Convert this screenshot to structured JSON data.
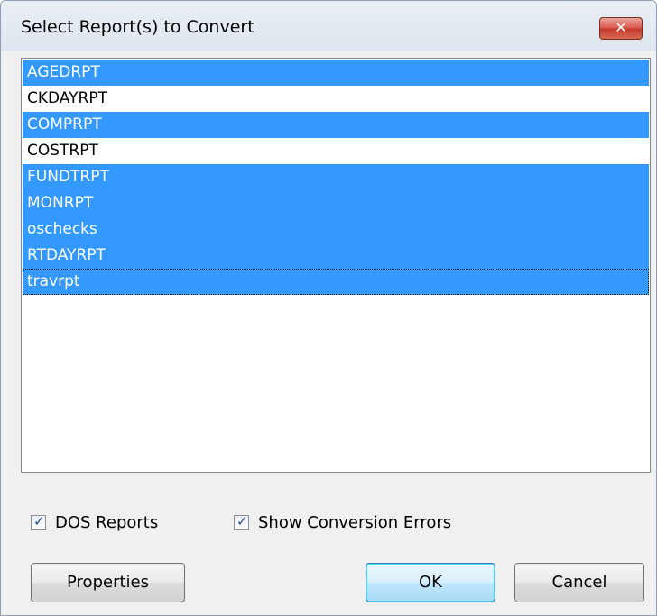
{
  "window": {
    "title": "Select Report(s) to Convert",
    "close_glyph": "✕"
  },
  "reports": [
    {
      "name": "AGEDRPT",
      "selected": true
    },
    {
      "name": "CKDAYRPT",
      "selected": false
    },
    {
      "name": "COMPRPT",
      "selected": true
    },
    {
      "name": "COSTRPT",
      "selected": false
    },
    {
      "name": "FUNDTRPT",
      "selected": true
    },
    {
      "name": "MONRPT",
      "selected": true
    },
    {
      "name": "oschecks",
      "selected": true
    },
    {
      "name": "RTDAYRPT",
      "selected": true
    },
    {
      "name": "travrpt",
      "selected": true,
      "focused": true
    }
  ],
  "options": {
    "dos_reports": {
      "label": "DOS Reports",
      "checked": true
    },
    "show_errors": {
      "label": "Show Conversion Errors",
      "checked": true
    }
  },
  "buttons": {
    "properties": "Properties",
    "ok": "OK",
    "cancel": "Cancel"
  },
  "colors": {
    "selection": "#3399ff",
    "close_button": "#c94a3c"
  }
}
